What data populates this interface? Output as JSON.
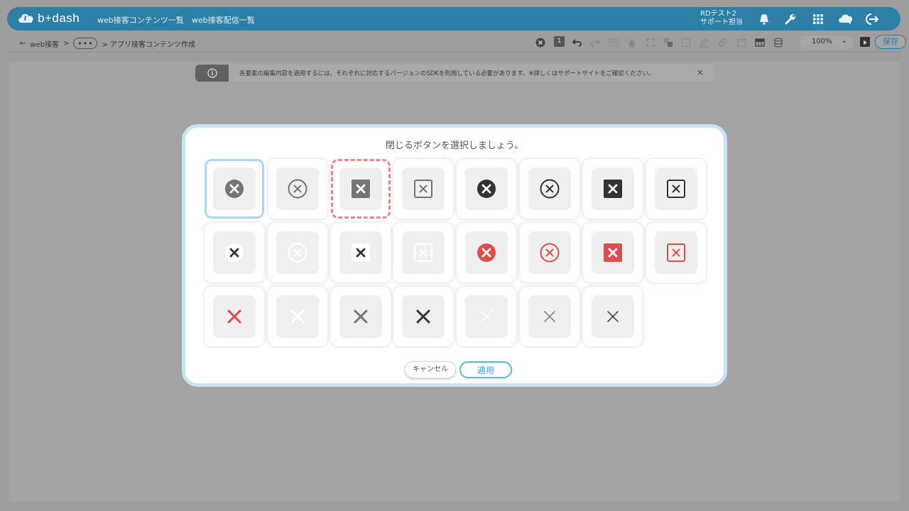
{
  "header": {
    "logo": "b+dash",
    "nav": [
      "web接客コンテンツ一覧",
      "web接客配信一覧"
    ],
    "user_line1": "RDテスト2",
    "user_line2": "サポート担当",
    "icons": [
      "bell-icon",
      "wrench-icon",
      "apps-grid-icon",
      "chat-cloud-icon",
      "logout-icon"
    ]
  },
  "toolbar": {
    "back_label": "←",
    "crumb_root": "web接客",
    "crumb_sep": ">",
    "more_label": "•••",
    "crumb_current": "> アプリ接客コンテンツ作成",
    "layer_badge": "1",
    "zoom": "100%",
    "save_label": "保存",
    "icons": [
      "close-circle-icon",
      "layer-badge-icon",
      "undo-icon",
      "redo-icon",
      "image-icon",
      "drop-icon",
      "expand-icon",
      "group-icon",
      "checkbox-icon",
      "pen-icon",
      "link-icon",
      "calendar-icon",
      "table-icon",
      "database-icon"
    ]
  },
  "notice": {
    "icon": "info-icon",
    "text": "各要素の編集内容を適用するには、それぞれに対応するバージョンのSDKを利用している必要があります。※詳しくはサポートサイトをご確認ください。",
    "close": "×"
  },
  "dialog": {
    "title": "閉じるボタンを選択しましょう。",
    "cancel_label": "キャンセル",
    "apply_label": "適用",
    "selected_index": 0,
    "hover_index": 2,
    "options": [
      {
        "style": "circle-filled",
        "color": "#757575"
      },
      {
        "style": "circle-outline",
        "color": "#757575"
      },
      {
        "style": "square-filled",
        "color": "#757575"
      },
      {
        "style": "square-outline",
        "color": "#757575"
      },
      {
        "style": "circle-filled",
        "color": "#333333"
      },
      {
        "style": "circle-outline",
        "color": "#333333"
      },
      {
        "style": "square-filled",
        "color": "#333333"
      },
      {
        "style": "square-outline",
        "color": "#333333"
      },
      {
        "style": "circle-white",
        "color": "#333333"
      },
      {
        "style": "circle-outline",
        "color": "#ffffff"
      },
      {
        "style": "square-white",
        "color": "#333333"
      },
      {
        "style": "square-outline",
        "color": "#ffffff"
      },
      {
        "style": "circle-filled",
        "color": "#e04b4b"
      },
      {
        "style": "circle-outline",
        "color": "#e04b4b"
      },
      {
        "style": "square-filled",
        "color": "#e04b4b"
      },
      {
        "style": "square-outline",
        "color": "#e04b4b"
      },
      {
        "style": "x-bold",
        "color": "#e04b4b"
      },
      {
        "style": "x-bold",
        "color": "#ffffff"
      },
      {
        "style": "x-bold",
        "color": "#757575"
      },
      {
        "style": "x-bold",
        "color": "#333333"
      },
      {
        "style": "x-thin",
        "color": "#ffffff"
      },
      {
        "style": "x-thin",
        "color": "#757575"
      },
      {
        "style": "x-thin",
        "color": "#333333"
      }
    ]
  }
}
